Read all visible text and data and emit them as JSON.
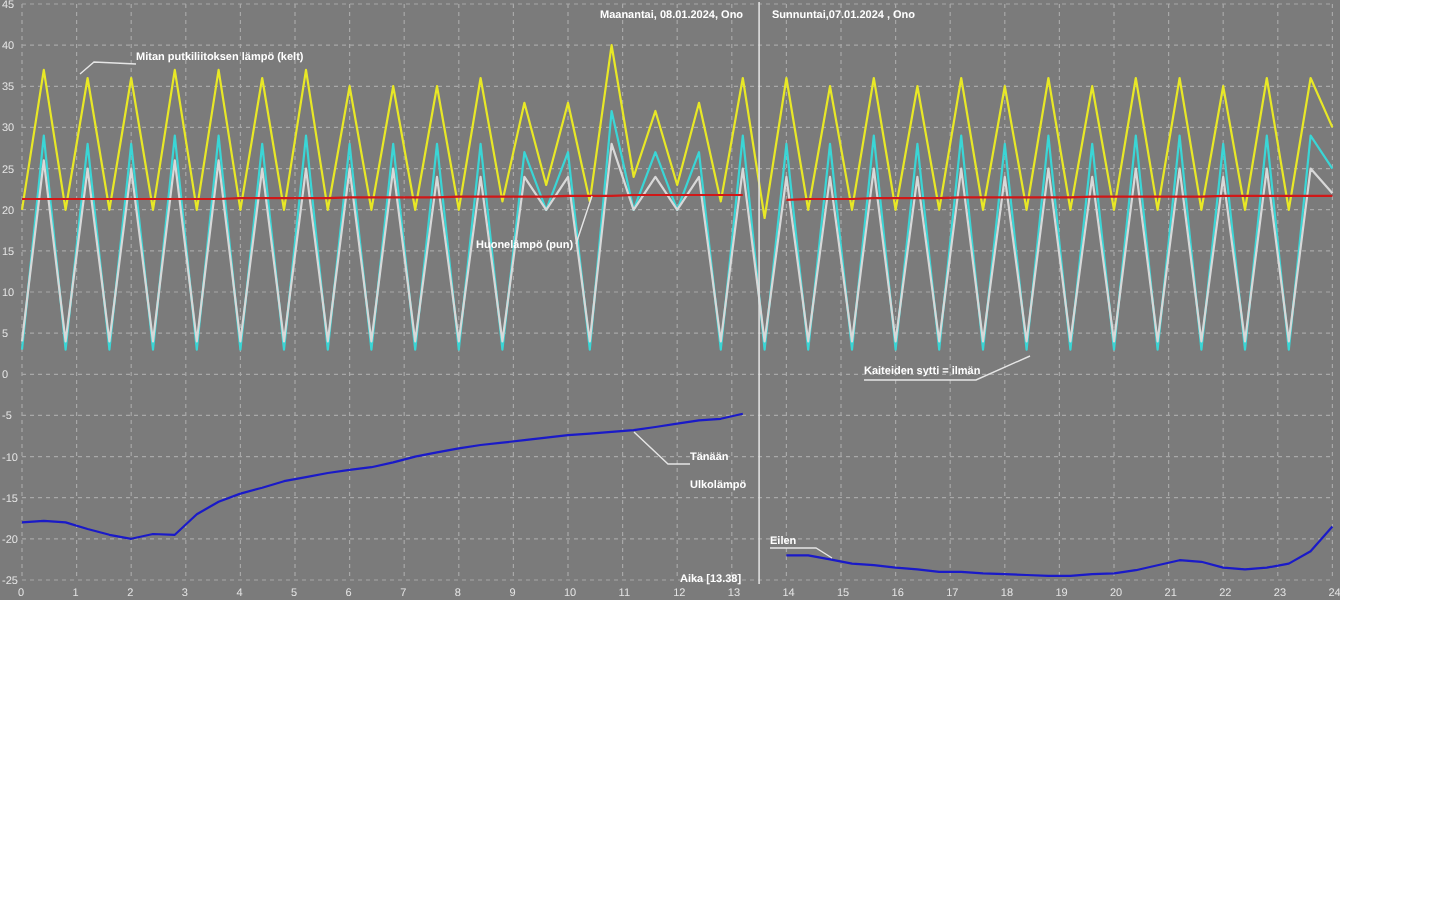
{
  "chart": {
    "chart_data": {
      "type": "line",
      "title": "Maanantai, 08.01.2024, Ono",
      "xlabel": "Aika [13.38]",
      "x": [
        0,
        0.4,
        0.8,
        1.2,
        1.6,
        2,
        2.4,
        2.8,
        3.2,
        3.6,
        4,
        4.4,
        4.8,
        5.2,
        5.6,
        6,
        6.4,
        6.8,
        7.2,
        7.6,
        8,
        8.4,
        8.8,
        9.2,
        9.6,
        10,
        10.4,
        10.8,
        11.2,
        11.6,
        12,
        12.4,
        12.8,
        13.2,
        13.6,
        14,
        14.4,
        14.8,
        15.2,
        15.6,
        16,
        16.4,
        16.8,
        17.2,
        17.6,
        18,
        18.4,
        18.8,
        19.2,
        19.6,
        20,
        20.4,
        20.8,
        21.2,
        21.6,
        22,
        22.4,
        22.8,
        23.2,
        23.6,
        24
      ],
      "series": [
        {
          "color": "#e8e826",
          "values": [
            20,
            37,
            20,
            36,
            20,
            36,
            20,
            37,
            20,
            37,
            20,
            36,
            20,
            37,
            20,
            35,
            20,
            35,
            20,
            35,
            20,
            36,
            21,
            33,
            23,
            33,
            21,
            40,
            24,
            32,
            23,
            33,
            21,
            36,
            19,
            36,
            20,
            35,
            20,
            36,
            20,
            35,
            20,
            36,
            20,
            35,
            20,
            36,
            20,
            35,
            20,
            36,
            20,
            36,
            20,
            35,
            20,
            36,
            20,
            36,
            30
          ]
        },
        {
          "color": "#3ad6d6",
          "values": [
            3,
            29,
            3,
            28,
            3,
            28,
            3,
            29,
            3,
            29,
            3,
            28,
            3,
            29,
            3,
            28,
            3,
            28,
            3,
            28,
            3,
            28,
            3,
            27,
            20,
            27,
            3,
            32,
            20,
            27,
            20,
            27,
            3,
            29,
            3,
            28,
            3,
            28,
            3,
            29,
            3,
            28,
            3,
            29,
            3,
            28,
            3,
            29,
            3,
            28,
            3,
            29,
            3,
            29,
            3,
            28,
            3,
            29,
            3,
            29,
            25
          ]
        },
        {
          "color": "#d8d8d8",
          "values": [
            4,
            26,
            4,
            25,
            4,
            25,
            4,
            26,
            4,
            26,
            4,
            25,
            4,
            25,
            4,
            25,
            4,
            25,
            4,
            24,
            4,
            24,
            4,
            24,
            20,
            24,
            4,
            28,
            20,
            24,
            20,
            24,
            4,
            25,
            4,
            24,
            4,
            24,
            4,
            25,
            4,
            24,
            4,
            25,
            4,
            24,
            4,
            25,
            4,
            24,
            4,
            25,
            4,
            25,
            4,
            24,
            4,
            25,
            4,
            25,
            22
          ]
        },
        {
          "color": "#d01818",
          "values": [
            21.3,
            21.3,
            21.3,
            21.3,
            21.3,
            21.3,
            21.3,
            21.3,
            21.3,
            21.3,
            21.4,
            21.4,
            21.4,
            21.4,
            21.4,
            21.5,
            21.5,
            21.5,
            21.5,
            21.5,
            21.6,
            21.6,
            21.6,
            21.6,
            21.6,
            21.7,
            21.7,
            21.7,
            21.8,
            21.8,
            21.8,
            21.8,
            21.8,
            21.8,
            null,
            21.2,
            21.3,
            21.3,
            21.3,
            21.4,
            21.4,
            21.4,
            21.4,
            21.5,
            21.5,
            21.5,
            21.5,
            21.5,
            21.5,
            21.6,
            21.6,
            21.6,
            21.6,
            21.6,
            21.6,
            21.7,
            21.7,
            21.7,
            21.7,
            21.7,
            21.7
          ]
        },
        {
          "color": "#1a1ac8",
          "values": [
            -18,
            -17.8,
            -18,
            -18.8,
            -19.5,
            -20,
            -19.4,
            -19.5,
            -17,
            -15.5,
            -14.5,
            -13.8,
            -13,
            -12.5,
            -12,
            -11.6,
            -11.3,
            -10.7,
            -10,
            -9.5,
            -9,
            -8.6,
            -8.3,
            -8,
            -7.7,
            -7.4,
            -7.2,
            -7,
            -6.8,
            -6.4,
            -6,
            -5.6,
            -5.4,
            -4.8,
            null,
            -22,
            -22,
            -22.5,
            -23,
            -23.2,
            -23.5,
            -23.7,
            -24,
            -24,
            -24.2,
            -24.3,
            -24.4,
            -24.5,
            -24.5,
            -24.3,
            -24.2,
            -23.8,
            -23.2,
            -22.6,
            -22.8,
            -23.5,
            -23.7,
            -23.5,
            -23,
            -21.5,
            -18.5
          ]
        }
      ],
      "xlim": [
        0,
        24
      ],
      "ylim": [
        -25,
        45
      ],
      "xticks": [
        0,
        1,
        2,
        3,
        4,
        5,
        6,
        7,
        8,
        9,
        10,
        11,
        12,
        13,
        14,
        15,
        16,
        17,
        18,
        19,
        20,
        21,
        22,
        23,
        24
      ],
      "yticks": [
        45,
        40,
        35,
        30,
        25,
        20,
        15,
        10,
        5,
        0,
        -5,
        -10,
        -15,
        -20,
        -25
      ],
      "annotations": [
        {
          "text": "Mitan putkiliitoksen lämpö (kelt)"
        },
        {
          "text": "Huonelämpö (pun)"
        },
        {
          "text": "Sunnuntai,07.01.2024 , Ono"
        },
        {
          "text": "Kaiteiden sytti = ilmän"
        },
        {
          "text": "Tänään"
        },
        {
          "text": "Ulkolämpö"
        },
        {
          "text": "Eilen"
        }
      ],
      "ref_lines": [
        {
          "axis": "x",
          "value": 13.5
        }
      ],
      "grid": true
    }
  }
}
